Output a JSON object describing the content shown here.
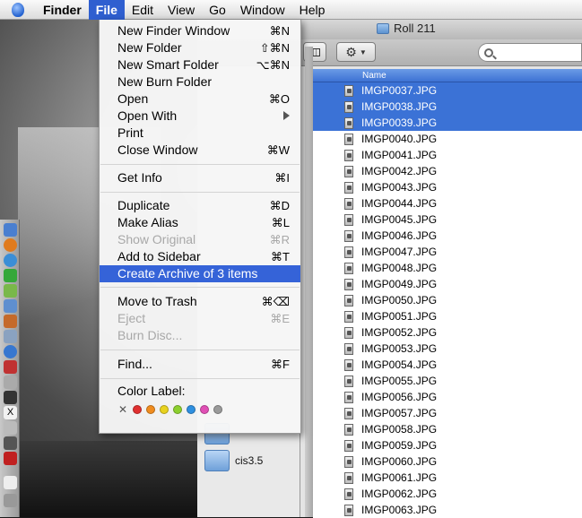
{
  "menubar": {
    "apple": "apple-icon",
    "items": [
      "Finder",
      "File",
      "Edit",
      "View",
      "Go",
      "Window",
      "Help"
    ]
  },
  "window": {
    "title": "Roll 211"
  },
  "sidebar": {
    "folder_label": "cis3.5"
  },
  "list": {
    "column_header": "Name",
    "rows": [
      {
        "name": "IMGP0037.JPG",
        "selected": true
      },
      {
        "name": "IMGP0038.JPG",
        "selected": true
      },
      {
        "name": "IMGP0039.JPG",
        "selected": true
      },
      {
        "name": "IMGP0040.JPG"
      },
      {
        "name": "IMGP0041.JPG"
      },
      {
        "name": "IMGP0042.JPG"
      },
      {
        "name": "IMGP0043.JPG"
      },
      {
        "name": "IMGP0044.JPG"
      },
      {
        "name": "IMGP0045.JPG"
      },
      {
        "name": "IMGP0046.JPG"
      },
      {
        "name": "IMGP0047.JPG"
      },
      {
        "name": "IMGP0048.JPG"
      },
      {
        "name": "IMGP0049.JPG"
      },
      {
        "name": "IMGP0050.JPG"
      },
      {
        "name": "IMGP0051.JPG"
      },
      {
        "name": "IMGP0052.JPG"
      },
      {
        "name": "IMGP0053.JPG"
      },
      {
        "name": "IMGP0054.JPG"
      },
      {
        "name": "IMGP0055.JPG"
      },
      {
        "name": "IMGP0056.JPG"
      },
      {
        "name": "IMGP0057.JPG"
      },
      {
        "name": "IMGP0058.JPG"
      },
      {
        "name": "IMGP0059.JPG"
      },
      {
        "name": "IMGP0060.JPG"
      },
      {
        "name": "IMGP0061.JPG"
      },
      {
        "name": "IMGP0062.JPG"
      },
      {
        "name": "IMGP0063.JPG"
      }
    ]
  },
  "file_menu": {
    "new_finder_window": {
      "label": "New Finder Window",
      "shortcut": "⌘N"
    },
    "new_folder": {
      "label": "New Folder",
      "shortcut": "⇧⌘N"
    },
    "new_smart_folder": {
      "label": "New Smart Folder",
      "shortcut": "⌥⌘N"
    },
    "new_burn_folder": {
      "label": "New Burn Folder"
    },
    "open": {
      "label": "Open",
      "shortcut": "⌘O"
    },
    "open_with": {
      "label": "Open With"
    },
    "print": {
      "label": "Print"
    },
    "close_window": {
      "label": "Close Window",
      "shortcut": "⌘W"
    },
    "get_info": {
      "label": "Get Info",
      "shortcut": "⌘I"
    },
    "duplicate": {
      "label": "Duplicate",
      "shortcut": "⌘D"
    },
    "make_alias": {
      "label": "Make Alias",
      "shortcut": "⌘L"
    },
    "show_original": {
      "label": "Show Original",
      "shortcut": "⌘R"
    },
    "add_to_sidebar": {
      "label": "Add to Sidebar",
      "shortcut": "⌘T"
    },
    "create_archive": {
      "label": "Create Archive of 3 items"
    },
    "move_to_trash": {
      "label": "Move to Trash",
      "shortcut": "⌘⌫"
    },
    "eject": {
      "label": "Eject",
      "shortcut": "⌘E"
    },
    "burn_disc": {
      "label": "Burn Disc..."
    },
    "find": {
      "label": "Find...",
      "shortcut": "⌘F"
    },
    "color_label": {
      "label": "Color Label:"
    },
    "label_colors": [
      "#e03030",
      "#f08c1e",
      "#e8d21e",
      "#8ccf2e",
      "#2e8fe0",
      "#e04fb5",
      "#9a9a9a"
    ]
  }
}
